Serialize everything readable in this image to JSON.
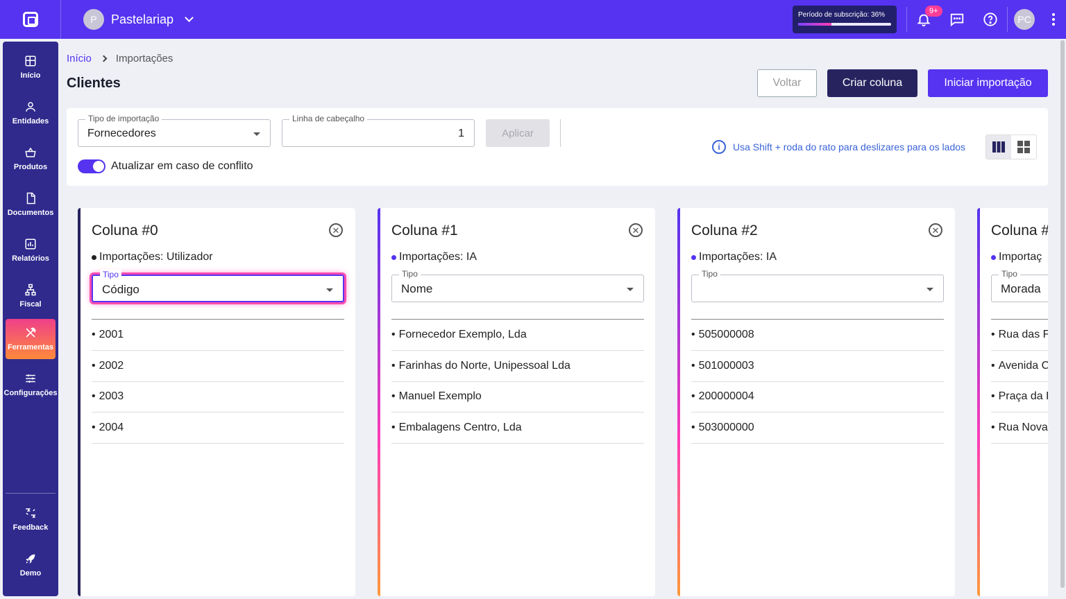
{
  "topbar": {
    "company_initial": "P",
    "company_name": "Pastelariap",
    "subscription_label": "Período de subscrição: 36%",
    "subscription_progress": 0.36,
    "notifications_badge": "9+",
    "user_initials": "PC"
  },
  "sidebar": {
    "items": [
      {
        "label": "Início",
        "icon": "home-icon"
      },
      {
        "label": "Entidades",
        "icon": "user-icon"
      },
      {
        "label": "Produtos",
        "icon": "basket-icon"
      },
      {
        "label": "Documentos",
        "icon": "document-icon"
      },
      {
        "label": "Relatórios",
        "icon": "chart-icon"
      },
      {
        "label": "Fiscal",
        "icon": "hierarchy-icon"
      },
      {
        "label": "Ferramentas",
        "icon": "tools-icon",
        "active": true
      },
      {
        "label": "Configurações",
        "icon": "sliders-icon"
      }
    ],
    "bottom": [
      {
        "label": "Feedback",
        "icon": "feedback-icon"
      },
      {
        "label": "Demo",
        "icon": "rocket-icon"
      }
    ]
  },
  "breadcrumb": {
    "home": "Início",
    "current": "Importações"
  },
  "page_title": "Clientes",
  "actions": {
    "back": "Voltar",
    "create_column": "Criar coluna",
    "start_import": "Iniciar importação"
  },
  "settings": {
    "import_type_label": "Tipo de importação",
    "import_type_value": "Fornecedores",
    "header_line_label": "Linha de cabeçalho",
    "header_line_value": "1",
    "apply": "Aplicar",
    "conflict_toggle_label": "Atualizar em caso de conflito",
    "conflict_toggle_on": true,
    "hint": "Usa Shift + roda do rato para deslizares para os lados"
  },
  "columns": [
    {
      "title": "Coluna #0",
      "imports": "Importações: Utilizador",
      "type_label": "Tipo",
      "type_value": "Código",
      "rows": [
        "2001",
        "2002",
        "2003",
        "2004"
      ]
    },
    {
      "title": "Coluna #1",
      "imports": "Importações: IA",
      "type_label": "Tipo",
      "type_value": "Nome",
      "rows": [
        "Fornecedor Exemplo, Lda",
        "Farinhas do Norte, Unipessoal Lda",
        "Manuel Exemplo",
        "Embalagens Centro, Lda"
      ]
    },
    {
      "title": "Coluna #2",
      "imports": "Importações: IA",
      "type_label": "Tipo",
      "type_value": "",
      "rows": [
        "505000008",
        "501000003",
        "200000004",
        "503000000"
      ]
    },
    {
      "title": "Coluna #",
      "imports": "Importaç",
      "type_label": "Tipo",
      "type_value": "Morada",
      "rows": [
        "Rua das F",
        "Avenida C",
        "Praça da F",
        "Rua Nova"
      ]
    }
  ],
  "colors": {
    "primary": "#5533f0",
    "sidebar": "#2f2a8c",
    "dark_button": "#27235f",
    "focus_glow": "#ff4db0"
  }
}
